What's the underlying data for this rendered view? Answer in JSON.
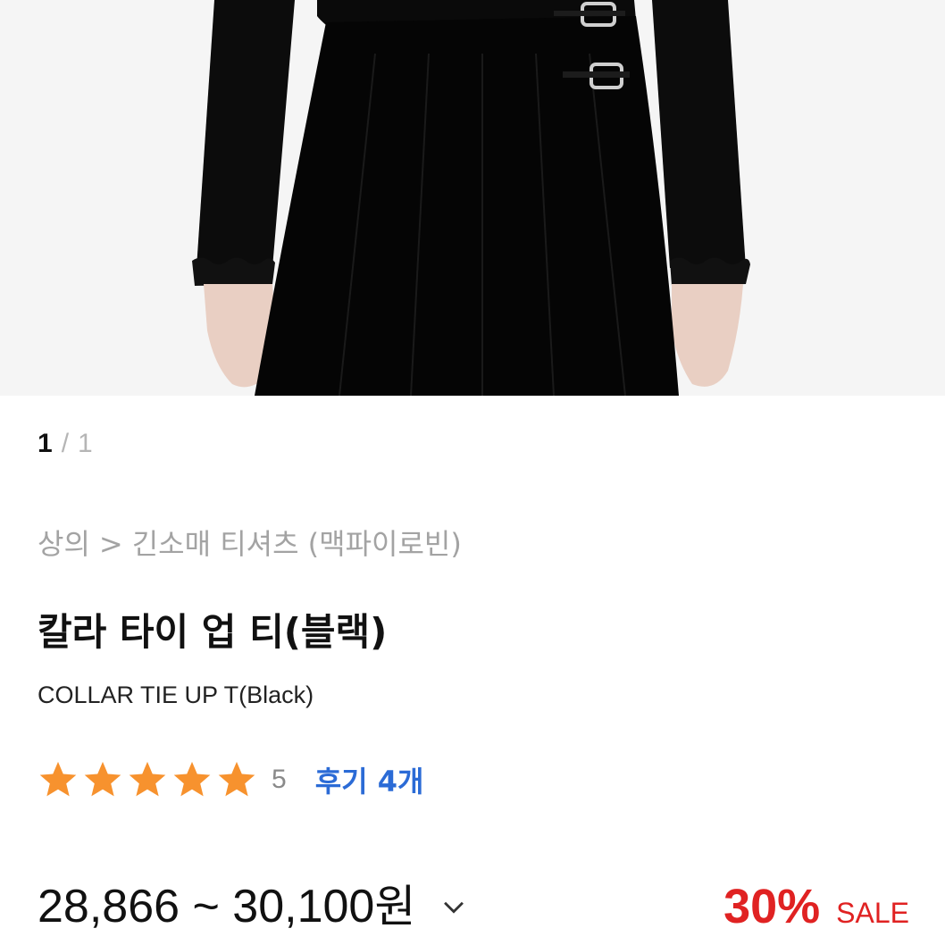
{
  "gallery": {
    "current": "1",
    "separator": "/",
    "total": "1",
    "image_description_icon": "product-photo"
  },
  "breadcrumb": {
    "category": "상의",
    "arrow": ">",
    "subcategory": "긴소매 티셔츠 (맥파이로빈)"
  },
  "product": {
    "title": "칼라 타이 업 티(블랙)",
    "subtitle": "COLLAR TIE UP T(Black)"
  },
  "rating": {
    "stars": 5,
    "max_stars": 5,
    "value": "5",
    "review_link": "후기 4개",
    "star_color": "#f7922e"
  },
  "price": {
    "range": "28,866 ~ 30,100",
    "currency": "원",
    "expand_icon": "chevron-down-icon"
  },
  "discount": {
    "percent": "30%",
    "label": "SALE",
    "color": "#e02222"
  },
  "colors": {
    "link": "#2b6bd6",
    "muted": "#a3a3a3"
  }
}
